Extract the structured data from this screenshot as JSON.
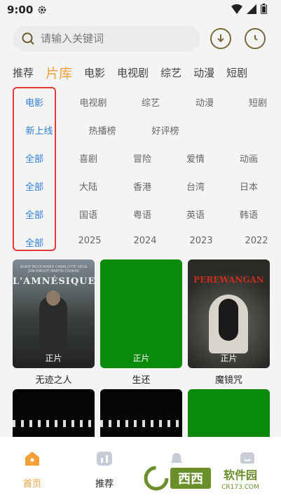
{
  "status": {
    "time": "9:00"
  },
  "search": {
    "placeholder": "请输入关键词"
  },
  "tabs": [
    "推荐",
    "片库",
    "电影",
    "电视剧",
    "综艺",
    "动漫",
    "短剧"
  ],
  "filters": [
    [
      "电影",
      "电视剧",
      "综艺",
      "动漫",
      "短剧"
    ],
    [
      "新上线",
      "热播榜",
      "好评榜"
    ],
    [
      "全部",
      "喜剧",
      "冒险",
      "爱情",
      "动画"
    ],
    [
      "全部",
      "大陆",
      "香港",
      "台湾",
      "日本"
    ],
    [
      "全部",
      "国语",
      "粤语",
      "英语",
      "韩语"
    ],
    [
      "全部",
      "2025",
      "2024",
      "2023",
      "2022"
    ]
  ],
  "cards": [
    {
      "title": "无迹之人",
      "tag": "正片",
      "poster_text": "L'AMNÉSIQUE",
      "poster_credits": "ADAM WOODWARD  CHARLOTTE VEGA  JON KNIGHT  MARTIN CSOKAS"
    },
    {
      "title": "生还",
      "tag": "正片"
    },
    {
      "title": "魔镜咒",
      "tag": "正片",
      "poster_text": "PEREWANGAN"
    },
    {
      "title": "",
      "tag": ""
    },
    {
      "title": "",
      "tag": ""
    },
    {
      "title": "",
      "tag": ""
    }
  ],
  "nav": [
    {
      "label": "首页",
      "icon": "home-icon"
    },
    {
      "label": "推荐",
      "icon": "chart-icon"
    },
    {
      "label": "",
      "icon": "bell-icon"
    },
    {
      "label": "",
      "icon": "profile-icon"
    }
  ],
  "watermark": {
    "text": "西西软件园",
    "url": "CR173.COM"
  },
  "colors": {
    "accent": "#f2a03a",
    "selected": "#2f80d8",
    "highlight": "#e53935",
    "green": "#0a8a0a"
  }
}
